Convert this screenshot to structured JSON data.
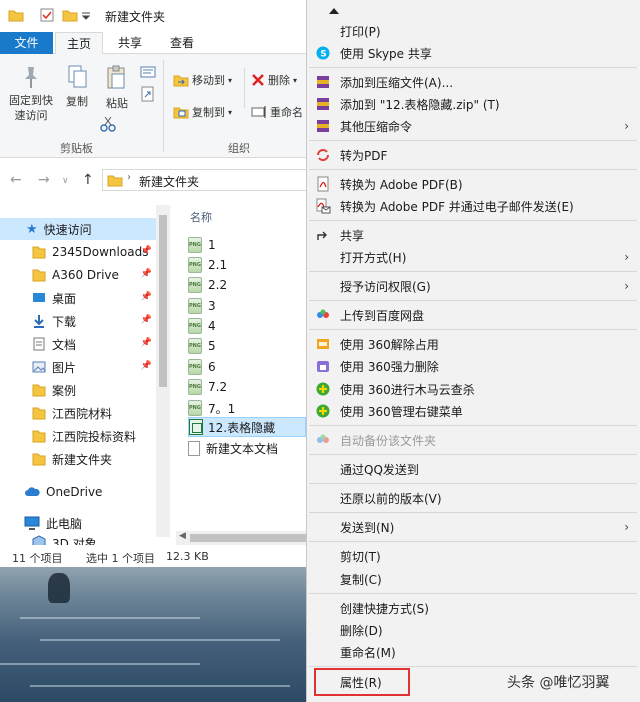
{
  "explorer": {
    "title": "新建文件夹",
    "tabs": {
      "file": "文件",
      "home": "主页",
      "share": "共享",
      "view": "查看"
    },
    "ribbon": {
      "pin_quick_access": "固定到快速访问",
      "copy": "复制",
      "paste": "粘贴",
      "move_to": "移动到",
      "copy_to": "复制到",
      "delete": "删除",
      "rename": "重命名",
      "clipboard_group": "剪贴板",
      "organize_group": "组织"
    },
    "address": "新建文件夹",
    "nav_items": [
      {
        "label": "快速访问"
      },
      {
        "label": "2345Downloads"
      },
      {
        "label": "A360 Drive"
      },
      {
        "label": "桌面"
      },
      {
        "label": "下载"
      },
      {
        "label": "文档"
      },
      {
        "label": "图片"
      },
      {
        "label": "案例"
      },
      {
        "label": "江西院材料"
      },
      {
        "label": "江西院投标资料"
      },
      {
        "label": "新建文件夹"
      },
      {
        "label": "OneDrive"
      },
      {
        "label": "此电脑"
      },
      {
        "label": "3D 对象"
      }
    ],
    "column_header": "名称",
    "files": [
      "1",
      "2.1",
      "2.2",
      "3",
      "4",
      "5",
      "6",
      "7.2",
      "7。1",
      "12.表格隐藏",
      "新建文本文档"
    ],
    "status": {
      "count": "11 个项目",
      "selected": "选中 1 个项目",
      "size": "12.3 KB"
    }
  },
  "menu": {
    "items": [
      {
        "label": "打印(P)"
      },
      {
        "label": "使用 Skype 共享"
      },
      {
        "label": "添加到压缩文件(A)..."
      },
      {
        "label": "添加到 \"12.表格隐藏.zip\" (T)"
      },
      {
        "label": "其他压缩命令"
      },
      {
        "label": "转为PDF"
      },
      {
        "label": "转换为 Adobe PDF(B)"
      },
      {
        "label": "转换为 Adobe PDF 并通过电子邮件发送(E)"
      },
      {
        "label": "共享"
      },
      {
        "label": "打开方式(H)"
      },
      {
        "label": "授予访问权限(G)"
      },
      {
        "label": "上传到百度网盘"
      },
      {
        "label": "使用 360解除占用"
      },
      {
        "label": "使用 360强力删除"
      },
      {
        "label": "使用 360进行木马云查杀"
      },
      {
        "label": "使用 360管理右键菜单"
      },
      {
        "label": "自动备份该文件夹"
      },
      {
        "label": "通过QQ发送到"
      },
      {
        "label": "还原以前的版本(V)"
      },
      {
        "label": "发送到(N)"
      },
      {
        "label": "剪切(T)"
      },
      {
        "label": "复制(C)"
      },
      {
        "label": "创建快捷方式(S)"
      },
      {
        "label": "删除(D)"
      },
      {
        "label": "重命名(M)"
      },
      {
        "label": "属性(R)"
      }
    ]
  },
  "watermark": "头条 @唯忆羽翼",
  "colors": {
    "accent": "#1979ca",
    "selection": "#cce8ff",
    "highlight": "#e03232"
  }
}
